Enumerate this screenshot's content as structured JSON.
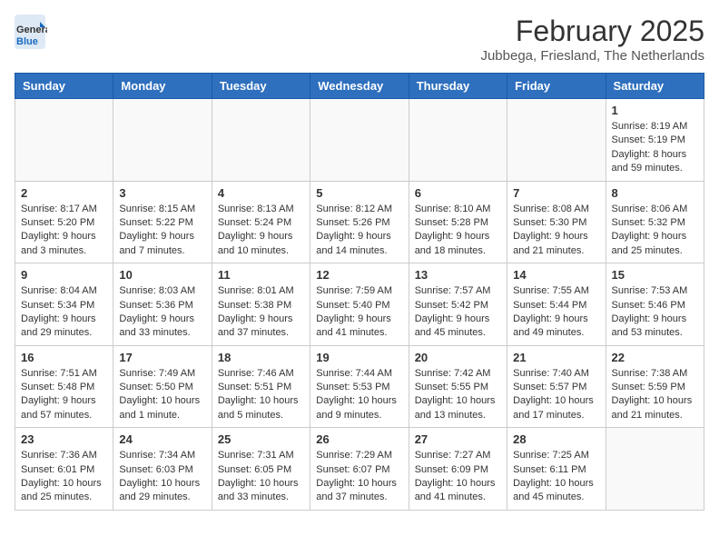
{
  "header": {
    "logo": {
      "general": "General",
      "blue": "Blue"
    },
    "title": "February 2025",
    "subtitle": "Jubbega, Friesland, The Netherlands"
  },
  "weekdays": [
    "Sunday",
    "Monday",
    "Tuesday",
    "Wednesday",
    "Thursday",
    "Friday",
    "Saturday"
  ],
  "weeks": [
    [
      {
        "day": null
      },
      {
        "day": null
      },
      {
        "day": null
      },
      {
        "day": null
      },
      {
        "day": null
      },
      {
        "day": null
      },
      {
        "day": 1,
        "sunrise": "Sunrise: 8:19 AM",
        "sunset": "Sunset: 5:19 PM",
        "daylight": "Daylight: 8 hours and 59 minutes."
      }
    ],
    [
      {
        "day": 2,
        "sunrise": "Sunrise: 8:17 AM",
        "sunset": "Sunset: 5:20 PM",
        "daylight": "Daylight: 9 hours and 3 minutes."
      },
      {
        "day": 3,
        "sunrise": "Sunrise: 8:15 AM",
        "sunset": "Sunset: 5:22 PM",
        "daylight": "Daylight: 9 hours and 7 minutes."
      },
      {
        "day": 4,
        "sunrise": "Sunrise: 8:13 AM",
        "sunset": "Sunset: 5:24 PM",
        "daylight": "Daylight: 9 hours and 10 minutes."
      },
      {
        "day": 5,
        "sunrise": "Sunrise: 8:12 AM",
        "sunset": "Sunset: 5:26 PM",
        "daylight": "Daylight: 9 hours and 14 minutes."
      },
      {
        "day": 6,
        "sunrise": "Sunrise: 8:10 AM",
        "sunset": "Sunset: 5:28 PM",
        "daylight": "Daylight: 9 hours and 18 minutes."
      },
      {
        "day": 7,
        "sunrise": "Sunrise: 8:08 AM",
        "sunset": "Sunset: 5:30 PM",
        "daylight": "Daylight: 9 hours and 21 minutes."
      },
      {
        "day": 8,
        "sunrise": "Sunrise: 8:06 AM",
        "sunset": "Sunset: 5:32 PM",
        "daylight": "Daylight: 9 hours and 25 minutes."
      }
    ],
    [
      {
        "day": 9,
        "sunrise": "Sunrise: 8:04 AM",
        "sunset": "Sunset: 5:34 PM",
        "daylight": "Daylight: 9 hours and 29 minutes."
      },
      {
        "day": 10,
        "sunrise": "Sunrise: 8:03 AM",
        "sunset": "Sunset: 5:36 PM",
        "daylight": "Daylight: 9 hours and 33 minutes."
      },
      {
        "day": 11,
        "sunrise": "Sunrise: 8:01 AM",
        "sunset": "Sunset: 5:38 PM",
        "daylight": "Daylight: 9 hours and 37 minutes."
      },
      {
        "day": 12,
        "sunrise": "Sunrise: 7:59 AM",
        "sunset": "Sunset: 5:40 PM",
        "daylight": "Daylight: 9 hours and 41 minutes."
      },
      {
        "day": 13,
        "sunrise": "Sunrise: 7:57 AM",
        "sunset": "Sunset: 5:42 PM",
        "daylight": "Daylight: 9 hours and 45 minutes."
      },
      {
        "day": 14,
        "sunrise": "Sunrise: 7:55 AM",
        "sunset": "Sunset: 5:44 PM",
        "daylight": "Daylight: 9 hours and 49 minutes."
      },
      {
        "day": 15,
        "sunrise": "Sunrise: 7:53 AM",
        "sunset": "Sunset: 5:46 PM",
        "daylight": "Daylight: 9 hours and 53 minutes."
      }
    ],
    [
      {
        "day": 16,
        "sunrise": "Sunrise: 7:51 AM",
        "sunset": "Sunset: 5:48 PM",
        "daylight": "Daylight: 9 hours and 57 minutes."
      },
      {
        "day": 17,
        "sunrise": "Sunrise: 7:49 AM",
        "sunset": "Sunset: 5:50 PM",
        "daylight": "Daylight: 10 hours and 1 minute."
      },
      {
        "day": 18,
        "sunrise": "Sunrise: 7:46 AM",
        "sunset": "Sunset: 5:51 PM",
        "daylight": "Daylight: 10 hours and 5 minutes."
      },
      {
        "day": 19,
        "sunrise": "Sunrise: 7:44 AM",
        "sunset": "Sunset: 5:53 PM",
        "daylight": "Daylight: 10 hours and 9 minutes."
      },
      {
        "day": 20,
        "sunrise": "Sunrise: 7:42 AM",
        "sunset": "Sunset: 5:55 PM",
        "daylight": "Daylight: 10 hours and 13 minutes."
      },
      {
        "day": 21,
        "sunrise": "Sunrise: 7:40 AM",
        "sunset": "Sunset: 5:57 PM",
        "daylight": "Daylight: 10 hours and 17 minutes."
      },
      {
        "day": 22,
        "sunrise": "Sunrise: 7:38 AM",
        "sunset": "Sunset: 5:59 PM",
        "daylight": "Daylight: 10 hours and 21 minutes."
      }
    ],
    [
      {
        "day": 23,
        "sunrise": "Sunrise: 7:36 AM",
        "sunset": "Sunset: 6:01 PM",
        "daylight": "Daylight: 10 hours and 25 minutes."
      },
      {
        "day": 24,
        "sunrise": "Sunrise: 7:34 AM",
        "sunset": "Sunset: 6:03 PM",
        "daylight": "Daylight: 10 hours and 29 minutes."
      },
      {
        "day": 25,
        "sunrise": "Sunrise: 7:31 AM",
        "sunset": "Sunset: 6:05 PM",
        "daylight": "Daylight: 10 hours and 33 minutes."
      },
      {
        "day": 26,
        "sunrise": "Sunrise: 7:29 AM",
        "sunset": "Sunset: 6:07 PM",
        "daylight": "Daylight: 10 hours and 37 minutes."
      },
      {
        "day": 27,
        "sunrise": "Sunrise: 7:27 AM",
        "sunset": "Sunset: 6:09 PM",
        "daylight": "Daylight: 10 hours and 41 minutes."
      },
      {
        "day": 28,
        "sunrise": "Sunrise: 7:25 AM",
        "sunset": "Sunset: 6:11 PM",
        "daylight": "Daylight: 10 hours and 45 minutes."
      },
      {
        "day": null
      }
    ]
  ]
}
